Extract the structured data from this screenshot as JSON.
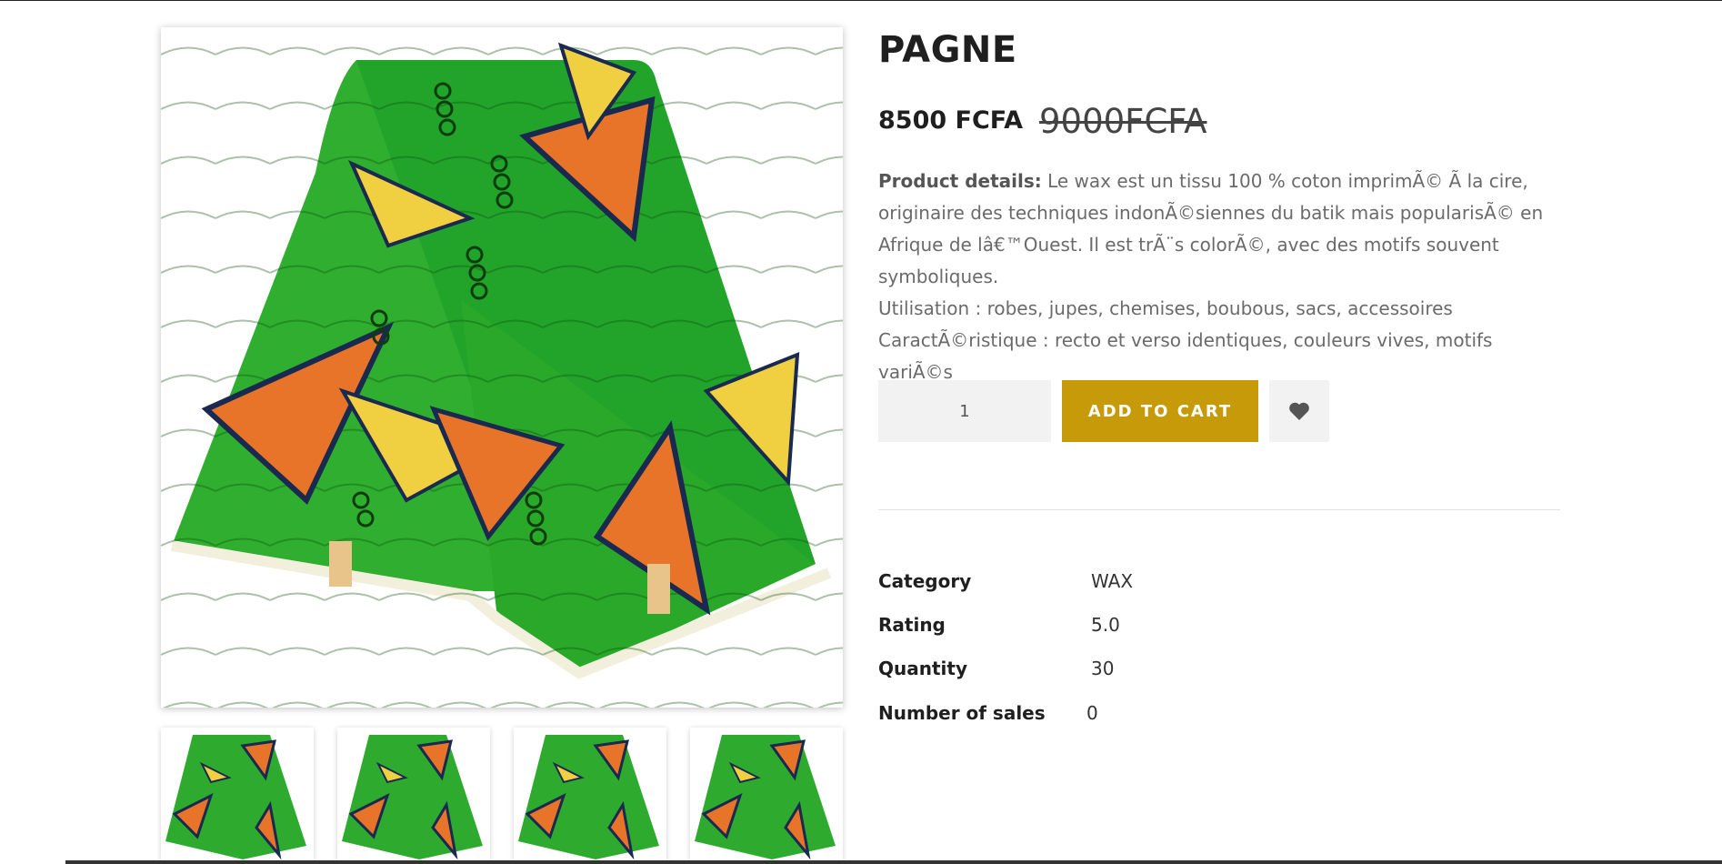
{
  "product": {
    "title": "PAGNE",
    "price": "8500 FCFA",
    "old_price": "9000FCFA",
    "details_label": "Product details:",
    "details_text": " Le wax est un tissu 100 % coton imprimÃ© Ã  la cire, originaire des techniques indonÃ©siennes du batik mais popularisÃ© en Afrique de lâ€™Ouest. Il est trÃ¨s colorÃ©, avec des motifs souvent symboliques.",
    "usage": "Utilisation : robes, jupes, chemises, boubous, sacs, accessoires",
    "feature": "CaractÃ©ristique : recto et verso identiques, couleurs vives, motifs variÃ©s"
  },
  "cart": {
    "quantity": "1",
    "add_label": "ADD TO CART",
    "wishlist_icon": "heart-icon",
    "accent_color": "#c79a0a"
  },
  "specs": [
    {
      "key": "Category",
      "value": "WAX"
    },
    {
      "key": "Rating",
      "value": "5.0"
    },
    {
      "key": "Quantity",
      "value": "30"
    },
    {
      "key": "Number of sales",
      "value": "0"
    }
  ],
  "gallery": {
    "main_image": "wax-fabric-green-orange-image",
    "thumbnails": [
      "wax-fabric-thumbnail",
      "wax-fabric-thumbnail",
      "wax-fabric-thumbnail",
      "wax-fabric-thumbnail"
    ]
  }
}
